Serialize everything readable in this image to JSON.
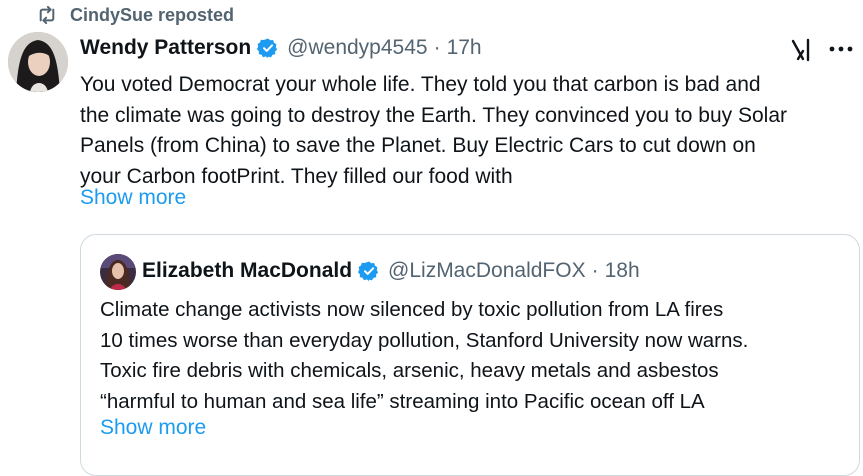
{
  "repost": {
    "icon": "repost-icon",
    "text": "CindySue reposted"
  },
  "tweet": {
    "author_name": "Wendy Patterson",
    "verified_icon": "verified-badge-icon",
    "handle": "@wendyp4545",
    "separator": "·",
    "time": "17h",
    "text": "You voted Democrat your whole life.  They told you that carbon is bad and\nthe climate was going to destroy the Earth. They convinced you to buy Solar\nPanels (from China) to save the Planet. Buy Electric Cars to cut down on\nyour Carbon footPrint. They filled our food with",
    "show_more": "Show more",
    "grok_icon": "grok-icon",
    "more_icon": "more-options-icon"
  },
  "quote": {
    "author_name": "Elizabeth MacDonald",
    "verified_icon": "verified-badge-icon",
    "handle": "@LizMacDonaldFOX",
    "separator": "·",
    "time": "18h",
    "text": "Climate change activists now silenced by toxic pollution from LA fires\n10 times worse than everyday pollution, Stanford University now warns.\nToxic fire debris with chemicals, arsenic, heavy metals and asbestos\n“harmful to human and sea life” streaming into Pacific ocean off LA",
    "show_more": "Show more"
  },
  "colors": {
    "link": "#1d9bf0",
    "muted": "#536471",
    "text": "#0f1419",
    "border": "#cfd9de"
  }
}
